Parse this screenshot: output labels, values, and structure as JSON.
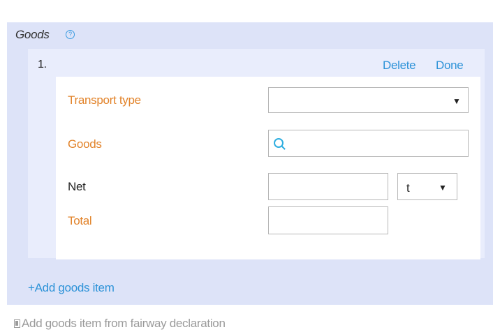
{
  "section": {
    "title": "Goods",
    "help_icon": "question-circle-icon",
    "help_glyph": "?"
  },
  "item": {
    "number": "1.",
    "delete_label": "Delete",
    "done_label": "Done",
    "transport_type": {
      "label": "Transport type",
      "value": "",
      "arrow": "▼"
    },
    "goods": {
      "label": "Goods",
      "value": "",
      "icon": "search-icon"
    },
    "net": {
      "label": "Net",
      "value": "",
      "unit": "t",
      "unit_arrow": "▼"
    },
    "total": {
      "label": "Total",
      "value": ""
    }
  },
  "actions": {
    "add_goods_item": "+Add goods item",
    "add_from_declaration": "Add goods item from fairway declaration"
  },
  "colors": {
    "panel_bg": "#dde3f8",
    "item_panel_bg": "#e9edfc",
    "link_blue": "#2e93d8",
    "required_label_orange": "#e2832a",
    "disabled_gray": "#9a9a9a"
  }
}
